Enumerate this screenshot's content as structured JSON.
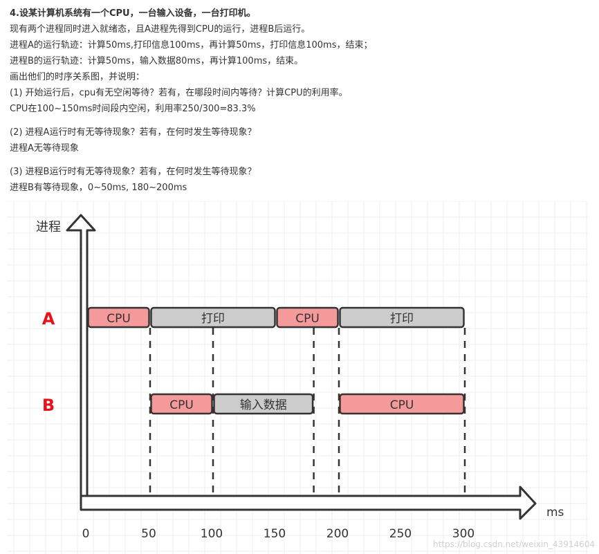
{
  "problem": {
    "title": "4.设某计算机系统有一个CPU，一台输入设备，一台打印机。",
    "intro": "现有两个进程同时进入就绪态，且A进程先得到CPU的运行，进程B后运行。",
    "process_a": "进程A的运行轨迹：计算50ms,打印信息100ms，再计算50ms，打印信息100ms，结束；",
    "process_b": "进程B的运行轨迹：计算50ms，输入数据80ms，再计算100ms，结束。",
    "instruction": "画出他们的时序关系图，并说明：",
    "q1": "(1) 开始运行后，cpu有无空闲等待？若有，在哪段时间内等待？计算CPU的利用率。",
    "a1": "CPU在100~150ms时间段内空闲，利用率250/300=83.3%",
    "q2": "(2) 进程A运行时有无等待现象？若有，在何时发生等待现象？",
    "a2": "进程A无等待现象",
    "q3": "(3) 进程B运行时有无等待现象？若有，在何时发生等待现象？",
    "a3": "进程B有等待现象，0~50ms, 180~200ms"
  },
  "diagram": {
    "y_axis_label": "进程",
    "x_axis_label": "ms",
    "x_ticks": [
      0,
      50,
      100,
      150,
      200,
      250,
      300
    ],
    "rows": [
      {
        "name": "A",
        "segments": [
          {
            "label": "CPU",
            "start": 0,
            "end": 50,
            "kind": "cpu"
          },
          {
            "label": "打印",
            "start": 50,
            "end": 150,
            "kind": "io"
          },
          {
            "label": "CPU",
            "start": 150,
            "end": 200,
            "kind": "cpu"
          },
          {
            "label": "打印",
            "start": 200,
            "end": 300,
            "kind": "io"
          }
        ]
      },
      {
        "name": "B",
        "segments": [
          {
            "label": "CPU",
            "start": 50,
            "end": 100,
            "kind": "cpu"
          },
          {
            "label": "输入数据",
            "start": 100,
            "end": 180,
            "kind": "io"
          },
          {
            "label": "CPU",
            "start": 200,
            "end": 300,
            "kind": "cpu"
          }
        ]
      }
    ],
    "dashed_markers": [
      50,
      100,
      180,
      200,
      300
    ],
    "colors": {
      "cpu": "#f59a9a",
      "io": "#cccccc",
      "row_label": "#e8121b",
      "outline": "#333333",
      "grid": "#eeeeee"
    },
    "watermark": "https://blog.csdn.net/weixin_43914604"
  }
}
